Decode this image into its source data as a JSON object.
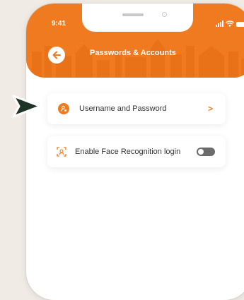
{
  "status_bar": {
    "time": "9:41"
  },
  "header": {
    "title": "Passwords & Accounts",
    "accent_color": "#ef7a1f"
  },
  "settings": [
    {
      "label": "Username and Password",
      "icon": "user-lock-icon",
      "action": "chevron"
    },
    {
      "label": "Enable Face Recognition login",
      "icon": "face-scan-icon",
      "action": "toggle",
      "enabled": false
    }
  ],
  "pointer": {
    "icon": "arrow-pointer-icon",
    "color": "#1f3326"
  }
}
